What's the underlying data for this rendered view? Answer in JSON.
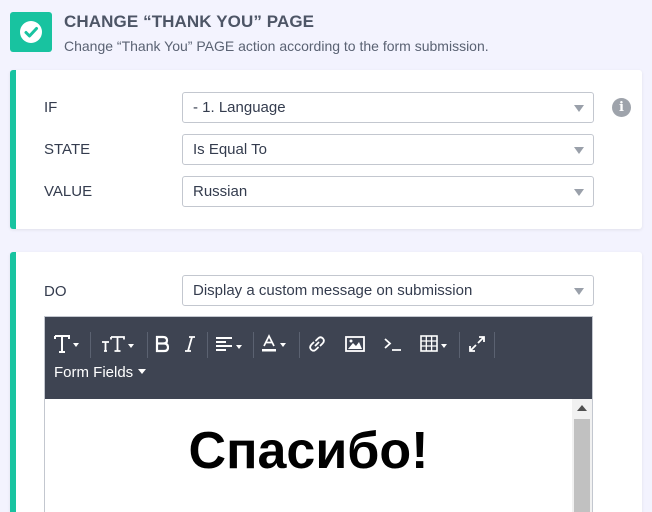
{
  "header": {
    "title": "CHANGE “THANK YOU” PAGE",
    "subtitle": "Change “Thank You” PAGE action according to the form submission."
  },
  "condition": {
    "if_label": "IF",
    "if_value": "- 1. Language",
    "state_label": "STATE",
    "state_value": "Is Equal To",
    "value_label": "VALUE",
    "value_value": "Russian"
  },
  "action": {
    "do_label": "DO",
    "do_value": "Display a custom message on submission"
  },
  "editor": {
    "toolbar": {
      "form_fields_label": "Form Fields"
    },
    "content_text": "Спасибо!"
  },
  "colors": {
    "accent": "#18c3a0",
    "toolbar_bg": "#3e4452",
    "page_bg": "#f3f3fe"
  }
}
